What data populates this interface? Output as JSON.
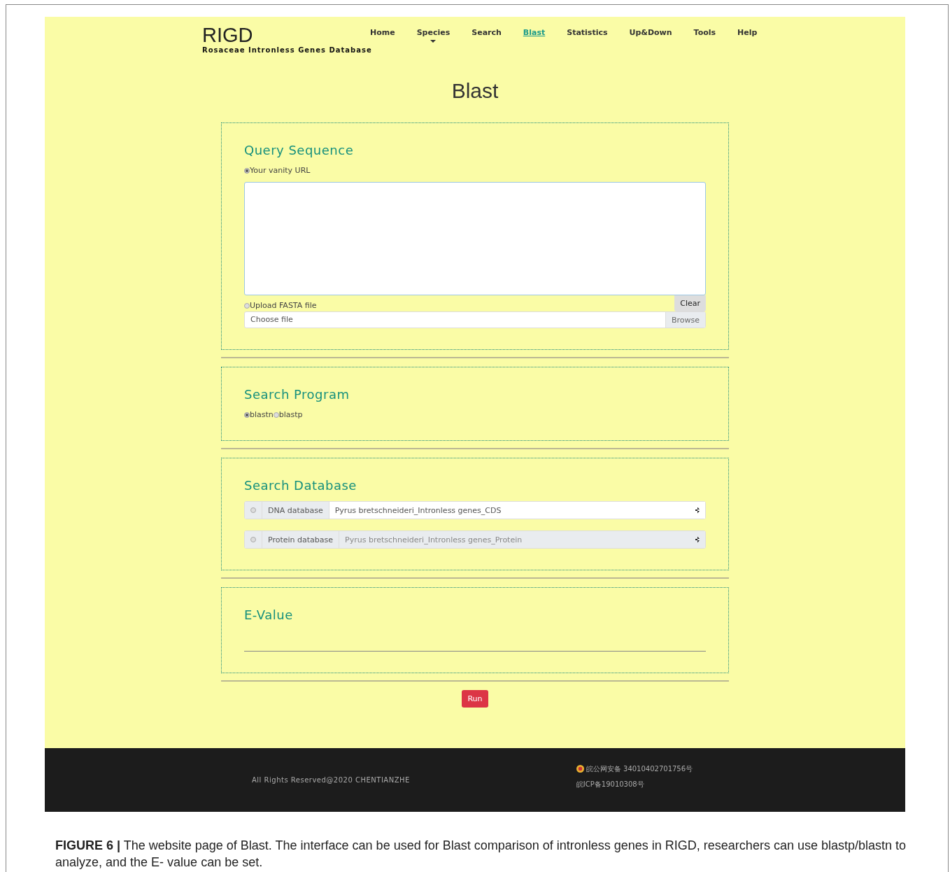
{
  "site": {
    "logo": "RIGD",
    "subtitle": "Rosaceae Intronless Genes Database"
  },
  "nav": [
    {
      "label": "Home",
      "selected": false,
      "dropdown": false
    },
    {
      "label": "Species",
      "selected": false,
      "dropdown": true
    },
    {
      "label": "Search",
      "selected": false,
      "dropdown": false
    },
    {
      "label": "Blast",
      "selected": true,
      "dropdown": false
    },
    {
      "label": "Statistics",
      "selected": false,
      "dropdown": false
    },
    {
      "label": "Up&Down",
      "selected": false,
      "dropdown": false
    },
    {
      "label": "Tools",
      "selected": false,
      "dropdown": false
    },
    {
      "label": "Help",
      "selected": false,
      "dropdown": false
    }
  ],
  "page_title": "Blast",
  "query": {
    "heading": "Query Sequence",
    "paste_option": {
      "label": "Your vanity URL",
      "selected": true
    },
    "clear_button": "Clear",
    "upload_option": {
      "label": "Upload FASTA file",
      "selected": false
    },
    "file_field": {
      "placeholder": "Choose file",
      "button": "Browse"
    }
  },
  "program": {
    "heading": "Search Program",
    "options": [
      {
        "label": "blastn",
        "selected": true
      },
      {
        "label": "blastp",
        "selected": false
      }
    ]
  },
  "database": {
    "heading": "Search Database",
    "rows": [
      {
        "label": "DNA database",
        "value": "Pyrus bretschneideri_Intronless genes_CDS",
        "selected": false,
        "disabled": false
      },
      {
        "label": "Protein database",
        "value": "Pyrus bretschneideri_Intronless genes_Protein",
        "selected": false,
        "disabled": true
      }
    ]
  },
  "evalue": {
    "heading": "E-Value"
  },
  "run_button": "Run",
  "footer": {
    "copyright": "All Rights Reserved@2020 CHENTIANZHE",
    "police_record": "皖公网安备 34010402701756号",
    "icp_record": "皖ICP备19010308号"
  },
  "caption": "**FIGURE 6 |** The website page of Blast. The interface can be used for Blast comparison of intronless genes in RIGD, researchers can use blastp/blastn to analyze, and the E- value can be set."
}
